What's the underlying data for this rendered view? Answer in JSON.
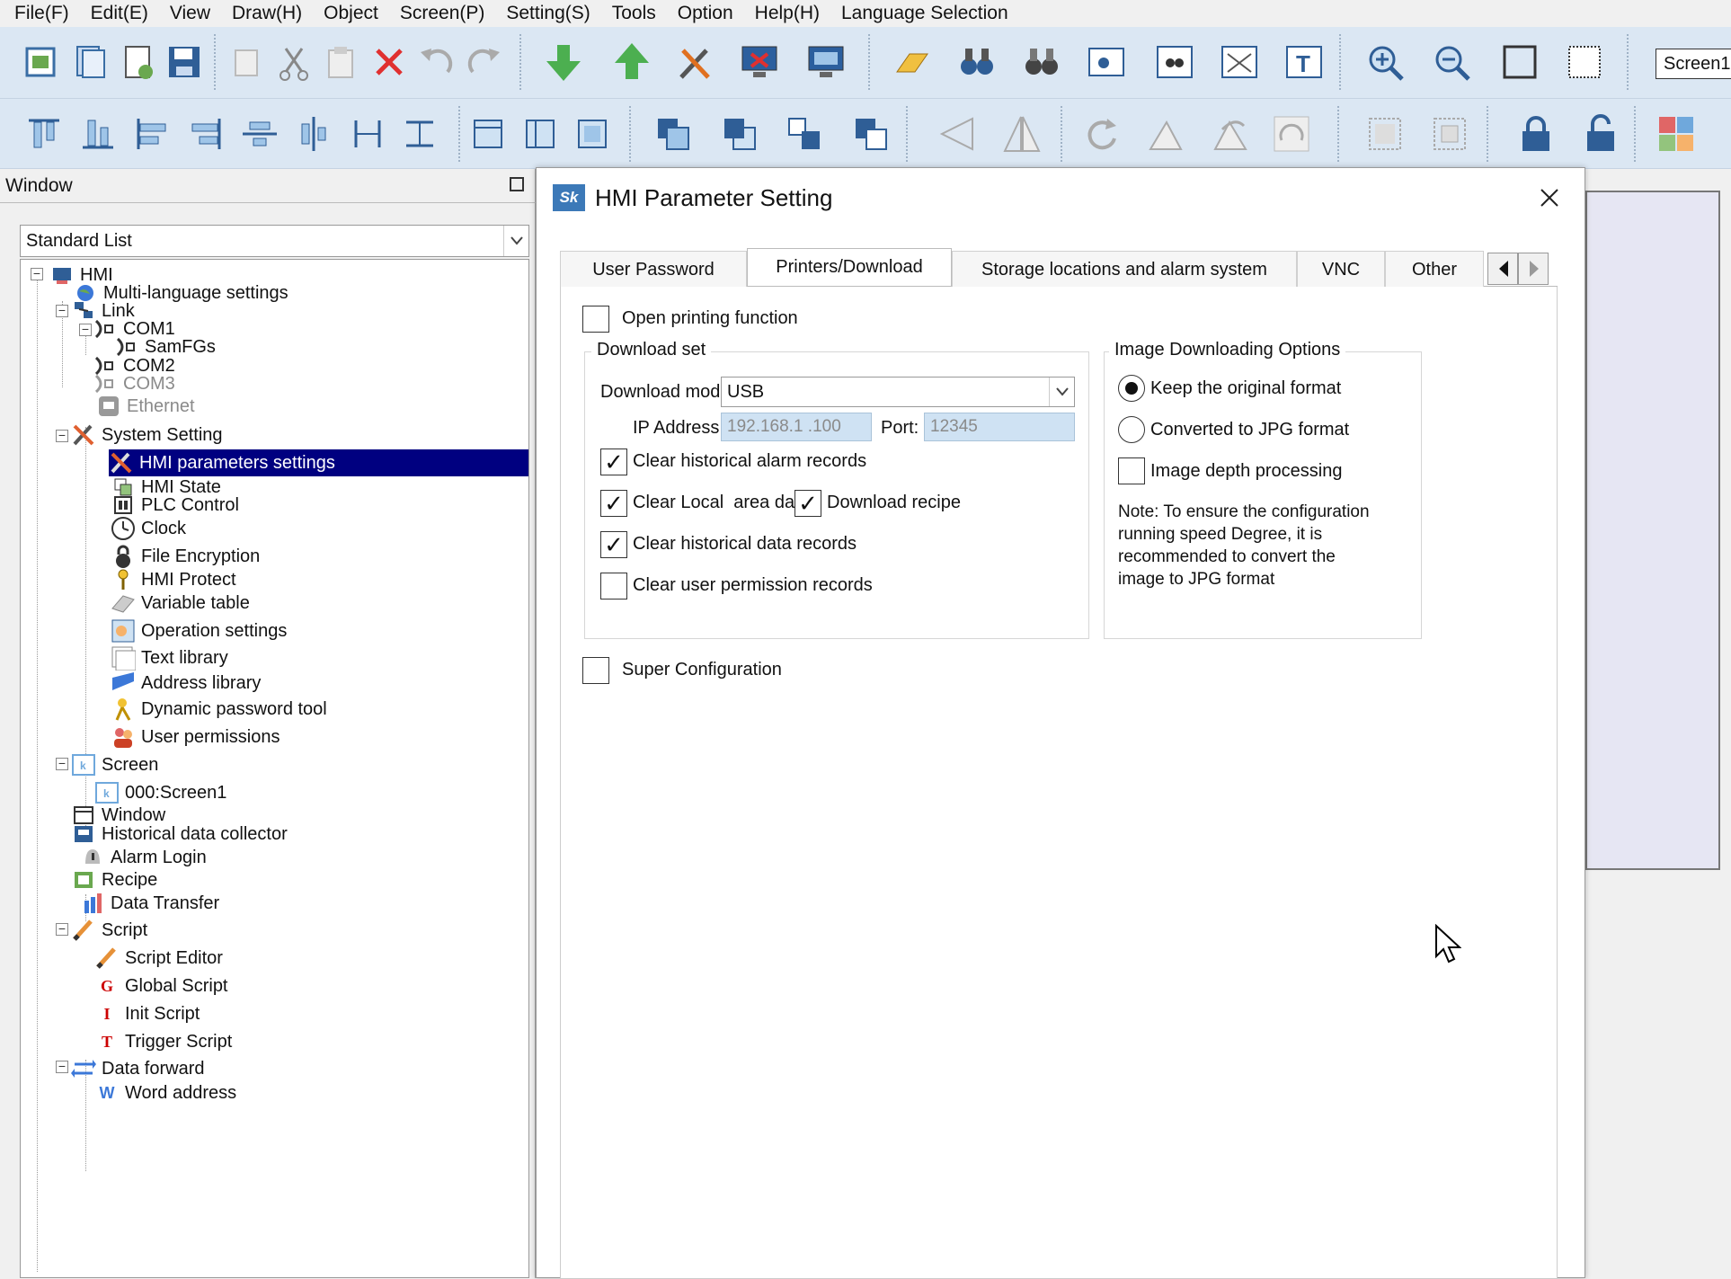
{
  "menu": [
    "File(F)",
    "Edit(E)",
    "View",
    "Draw(H)",
    "Object",
    "Screen(P)",
    "Setting(S)",
    "Tools",
    "Option",
    "Help(H)",
    "Language Selection"
  ],
  "toolbar": {
    "screen_selector": "Screen1"
  },
  "window_panel": {
    "title": "Window",
    "list_select": "Standard List",
    "tree": {
      "hmi": "HMI",
      "multi_language": "Multi-language settings",
      "link": "Link",
      "com1": "COM1",
      "samfgs": "SamFGs",
      "com2": "COM2",
      "com3": "COM3",
      "ethernet": "Ethernet",
      "system_setting": "System Setting",
      "hmi_parameters": "HMI parameters settings",
      "hmi_state": "HMI State",
      "plc_control": "PLC Control",
      "clock": "Clock",
      "file_encryption": "File Encryption",
      "hmi_protect": "HMI Protect",
      "variable_table": "Variable table",
      "operation_settings": "Operation settings",
      "text_library": "Text library",
      "address_library": "Address library",
      "dynamic_password": "Dynamic password tool",
      "user_permissions": "User permissions",
      "screen": "Screen",
      "screen1": "000:Screen1",
      "window": "Window",
      "historical_collector": "Historical data collector",
      "alarm_login": "Alarm Login",
      "recipe": "Recipe",
      "data_transfer": "Data Transfer",
      "script": "Script",
      "script_editor": "Script Editor",
      "global_script": "Global Script",
      "init_script": "Init Script",
      "trigger_script": "Trigger Script",
      "data_forward": "Data forward",
      "word_address": "Word address"
    }
  },
  "dialog": {
    "title": "HMI Parameter Setting",
    "app_icon": "Sk",
    "tabs": [
      "User Password",
      "Printers/Download",
      "Storage locations and alarm system",
      "VNC",
      "Other"
    ],
    "active_tab": "Printers/Download",
    "open_printing": {
      "label": "Open printing function",
      "checked": false
    },
    "download_set": {
      "title": "Download set",
      "mode_label": "Download mode:",
      "mode_value": "USB",
      "ip_label": "IP Address:",
      "ip_value": "192.168.1 .100",
      "port_label": "Port:",
      "port_value": "12345",
      "clear_alarm": {
        "label": "Clear historical alarm records",
        "checked": true
      },
      "clear_local": {
        "label": "Clear Local  area data",
        "checked": true
      },
      "download_recipe": {
        "label": "Download recipe",
        "checked": true
      },
      "clear_data": {
        "label": "Clear historical data records",
        "checked": true
      },
      "clear_permission": {
        "label": "Clear user permission records",
        "checked": false
      }
    },
    "image_options": {
      "title": "Image Downloading Options",
      "keep_original": {
        "label": "Keep the original format",
        "selected": true
      },
      "convert_jpg": {
        "label": "Converted to JPG format",
        "selected": false
      },
      "depth_processing": {
        "label": "Image depth processing",
        "checked": false
      },
      "note": "Note: To ensure the configuration\nrunning speed Degree, it is\nrecommended to convert the\nimage to JPG format"
    },
    "super_config": {
      "label": "Super Configuration",
      "checked": false
    }
  },
  "colors": {
    "selection": "#000080",
    "toolbar_bg": "#dbe7f3",
    "input_disabled": "#cfe2f3",
    "canvas": "#e6e6f3"
  }
}
